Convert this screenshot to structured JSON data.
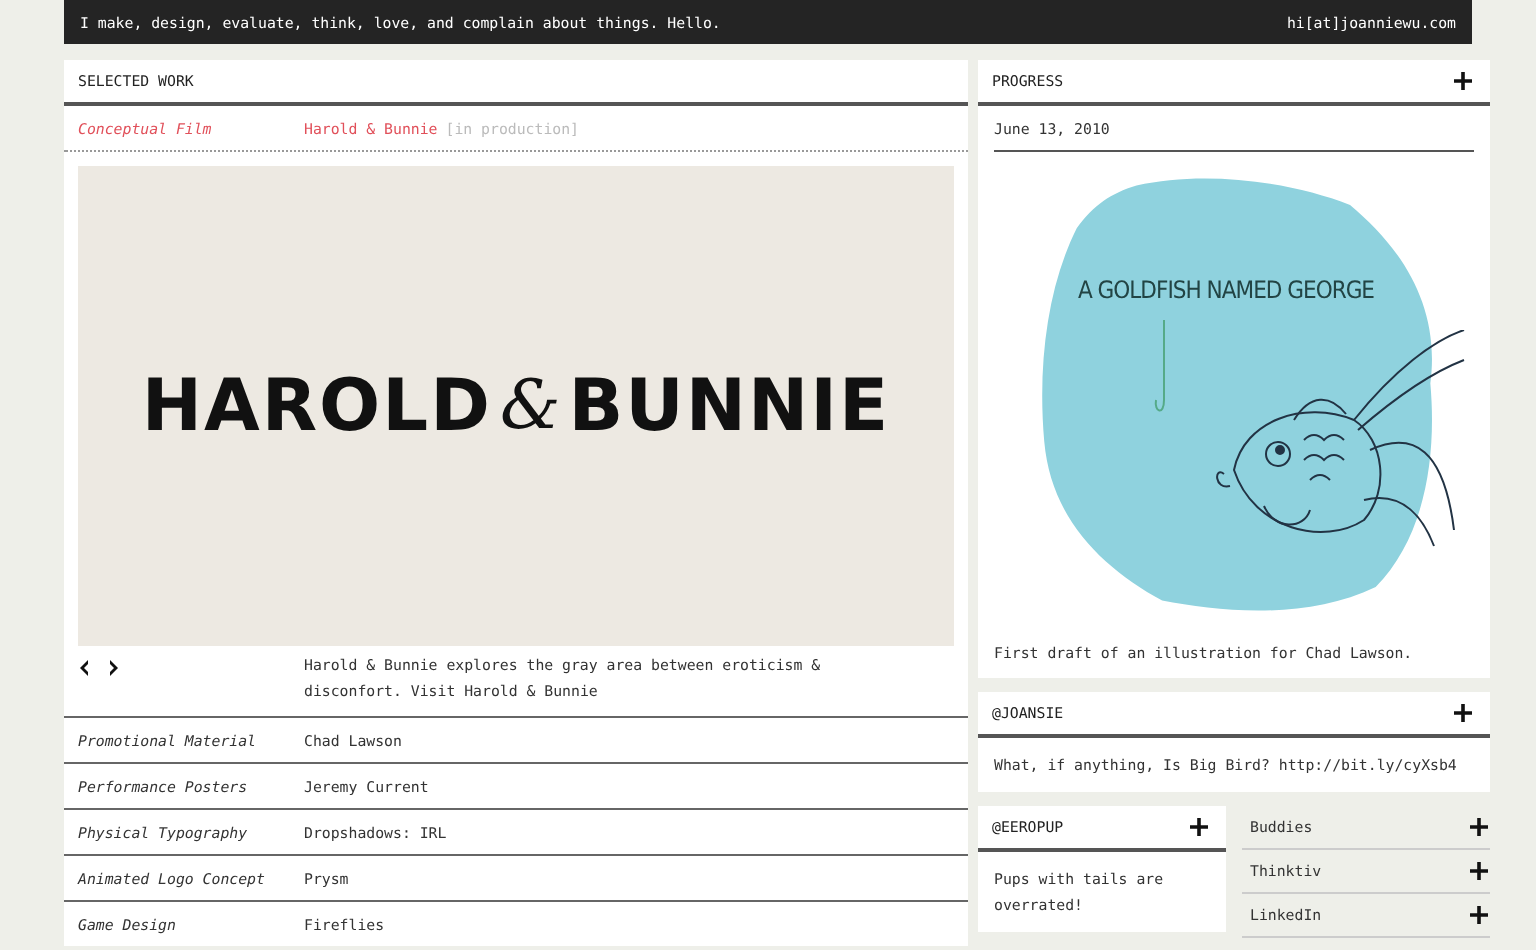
{
  "top_bar": {
    "tagline": "I make, design, evaluate, think, love, and complain about things. Hello.",
    "email": "hi[at]joanniewu.com"
  },
  "selected_work": {
    "title": "SELECTED WORK",
    "featured": {
      "category": "Conceptual Film",
      "title": "Harold & Bunnie",
      "status": "[in production]",
      "logo_left": "HAROLD",
      "logo_amp": "&",
      "logo_right": "BUNNIE",
      "description": "Harold & Bunnie explores the gray area between eroticism & disconfort.",
      "link": "Visit Harold & Bunnie"
    },
    "rows": [
      {
        "category": "Promotional Material",
        "title": "Chad Lawson"
      },
      {
        "category": "Performance Posters",
        "title": "Jeremy Current"
      },
      {
        "category": "Physical Typography",
        "title": "Dropshadows: IRL"
      },
      {
        "category": "Animated Logo Concept",
        "title": "Prysm"
      },
      {
        "category": "Game Design",
        "title": "Fireflies"
      }
    ]
  },
  "progress": {
    "title": "PROGRESS",
    "date": "June 13, 2010",
    "illustration_title": "A GOLDFISH NAMED GEORGE",
    "caption": "First draft of an illustration for Chad Lawson."
  },
  "joansie": {
    "title": "@JOANSIE",
    "tweet": "What, if anything, Is Big Bird? http://bit.ly/cyXsb4"
  },
  "eeropup": {
    "title": "@EEROPUP",
    "tweet": "Pups with tails are overrated!"
  },
  "links": [
    "Buddies",
    "Thinktiv",
    "LinkedIn"
  ]
}
